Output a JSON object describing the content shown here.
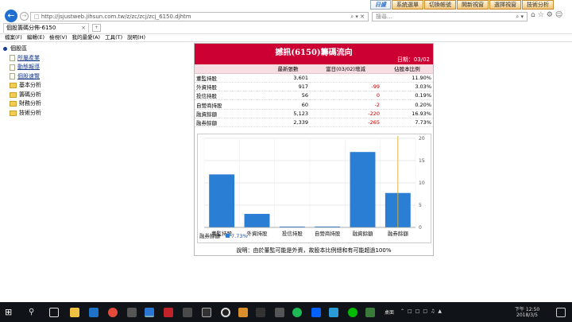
{
  "browser": {
    "url": "http://jsjustweb.jihsun.com.tw/z/zc/zcj/zcj_6150.djhtm",
    "search_placeholder": "搜尋...",
    "tab_title": "個股籌碼分佈-6150",
    "toplinks": [
      "日盛",
      "系統選單",
      "切換帳號",
      "開新視窗",
      "選擇視窗",
      "技術分析"
    ],
    "menu": [
      "檔案(F)",
      "編輯(E)",
      "檢視(V)",
      "我的最愛(A)",
      "工具(T)",
      "說明(H)"
    ]
  },
  "sidebar": {
    "root": "個股區",
    "items": [
      {
        "label": "所屬產業",
        "type": "doc",
        "link": true
      },
      {
        "label": "動態報導",
        "type": "doc",
        "link": true
      },
      {
        "label": "個股速覽",
        "type": "doc",
        "link": true
      },
      {
        "label": "基本分析",
        "type": "folder",
        "link": false
      },
      {
        "label": "籌碼分析",
        "type": "folder",
        "link": false
      },
      {
        "label": "財務分析",
        "type": "folder",
        "link": false
      },
      {
        "label": "技術分析",
        "type": "folder",
        "link": false
      }
    ]
  },
  "panel": {
    "title": "撼訊(6150)籌碼流向",
    "date": "日期：03/02",
    "headers": [
      "",
      "最新張數",
      "當日(03/02)增減",
      "佔股本比例"
    ],
    "rows": [
      {
        "label": "董監持股",
        "latest": "3,601",
        "change": "",
        "ratio": "11.90%"
      },
      {
        "label": "外資持股",
        "latest": "917",
        "change": "-99",
        "ratio": "3.03%"
      },
      {
        "label": "投信持股",
        "latest": "56",
        "change": "0",
        "ratio": "0.19%"
      },
      {
        "label": "自營商持股",
        "latest": "60",
        "change": "-2",
        "ratio": "0.20%"
      },
      {
        "label": "融資餘額",
        "latest": "5,123",
        "change": "-220",
        "ratio": "16.93%"
      },
      {
        "label": "融券餘額",
        "latest": "2,339",
        "change": "-265",
        "ratio": "7.73%"
      }
    ],
    "note": "說明：由於董監可能是外資，故股本比例總和有可能超過100%",
    "tooltip_label": "融券餘額",
    "tooltip_value": "7.73%"
  },
  "chart_data": {
    "type": "bar",
    "categories": [
      "董監持股",
      "外資持股",
      "投信持股",
      "自營商持股",
      "融資餘額",
      "融券餘額"
    ],
    "values": [
      11.9,
      3.03,
      0.19,
      0.2,
      16.93,
      7.73
    ],
    "yticks": [
      "0",
      "5",
      "10",
      "15",
      "20"
    ],
    "ylim": [
      0,
      20
    ],
    "grid": true,
    "bar_color": "#2a7fd4",
    "title": "",
    "xlabel": "",
    "ylabel": ""
  },
  "taskbar": {
    "time": "下午 12:50",
    "date": "2018/3/5",
    "desktop_label": "桌面"
  }
}
